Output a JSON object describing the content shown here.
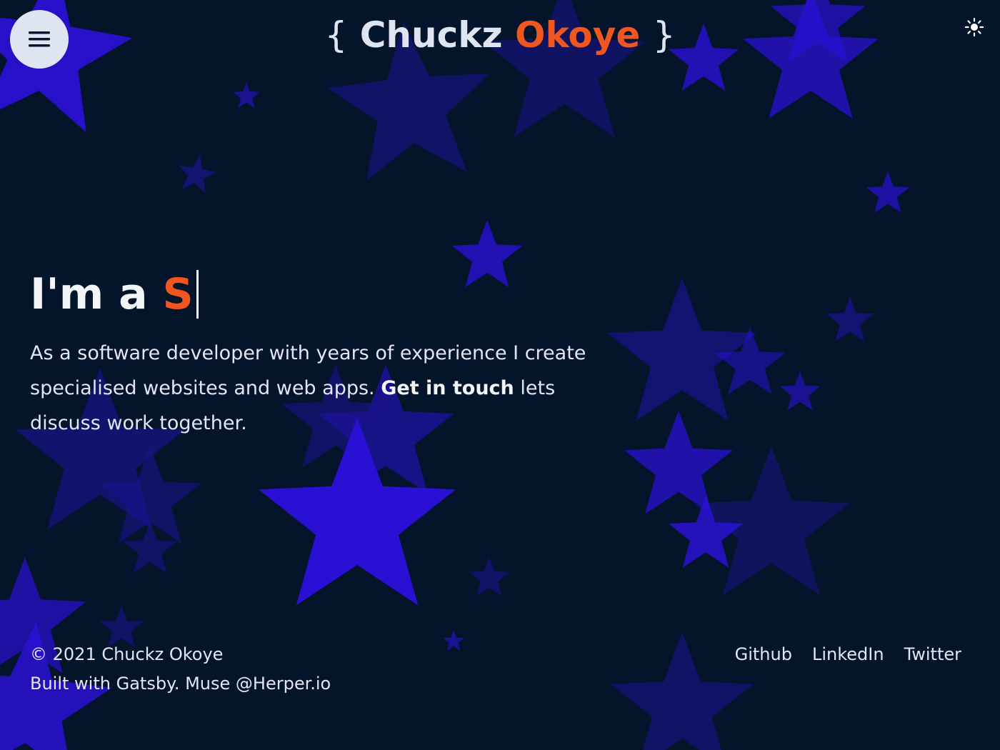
{
  "header": {
    "logo_open_brace": "{",
    "logo_first_name": "Chuckz",
    "logo_last_name": "Okoye",
    "logo_close_brace": "}",
    "menu_icon": "hamburger-menu-icon",
    "theme_icon": "sun-icon"
  },
  "hero": {
    "headline_prefix": "I'm a",
    "headline_typed": "S",
    "intro_before": "As a software developer with years of experience I create specialised websites and web apps.",
    "intro_cta": "Get in touch",
    "intro_after": "lets discuss work together."
  },
  "footer": {
    "copyright": "© 2021 Chuckz Okoye",
    "credit": "Built with Gatsby. Muse @Herper.io",
    "links": [
      "Github",
      "LinkedIn",
      "Twitter"
    ]
  },
  "colors": {
    "background": "#04142b",
    "accent": "#f0561f",
    "star_bright": "#2a10d4",
    "star_dim": "#1a1390",
    "text": "#e3e6f2"
  }
}
